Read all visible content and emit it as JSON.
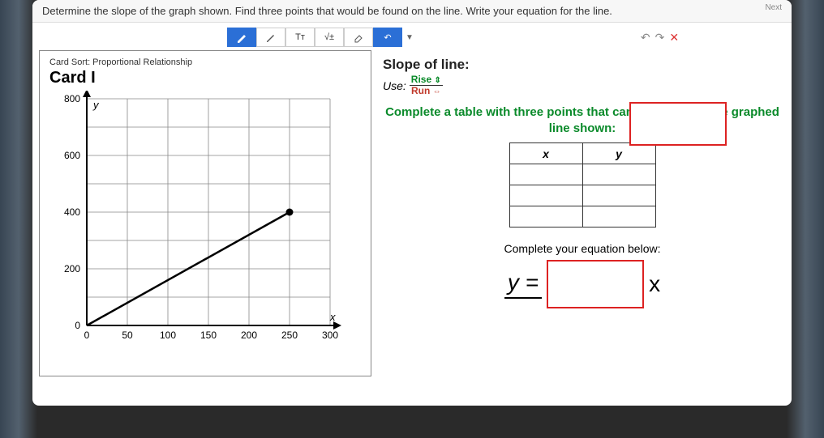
{
  "question": "Determine the slope of the graph shown. Find three points that would be found on the line. Write your equation for the line.",
  "nav_next": "Next",
  "toolbar": {
    "pen": "✎",
    "pencil": "✎",
    "tt": "Tᴛ",
    "sqrt": "√±",
    "eraser": "✐",
    "undo": "↶"
  },
  "undo_redo": {
    "undo": "↶",
    "redo": "↷",
    "close": "✕"
  },
  "card": {
    "sort_label": "Card Sort: Proportional Relationship",
    "title": "Card I",
    "axis_y_label": "y",
    "axis_x_label": "x",
    "y_ticks": [
      "0",
      "200",
      "400",
      "600",
      "800"
    ],
    "x_ticks": [
      "0",
      "50",
      "100",
      "150",
      "200",
      "250",
      "300"
    ]
  },
  "right": {
    "slope_title": "Slope of line:",
    "use_label": "Use:",
    "rise": "Rise",
    "rise_arrow": "⇕",
    "run": "Run",
    "run_arrow": "⇔",
    "instruction": "Complete a table with three points that can be found on the graphed line shown:",
    "col_x": "x",
    "col_y": "y",
    "eq_prompt": "Complete your equation below:",
    "eq_y": "y =",
    "eq_x": "x"
  },
  "chart_data": {
    "type": "line",
    "title": "Card I",
    "xlabel": "x",
    "ylabel": "y",
    "xlim": [
      0,
      300
    ],
    "ylim": [
      0,
      800
    ],
    "grid": true,
    "series": [
      {
        "name": "line",
        "x": [
          0,
          250
        ],
        "y": [
          0,
          400
        ]
      }
    ],
    "marked_point": {
      "x": 250,
      "y": 400
    }
  }
}
